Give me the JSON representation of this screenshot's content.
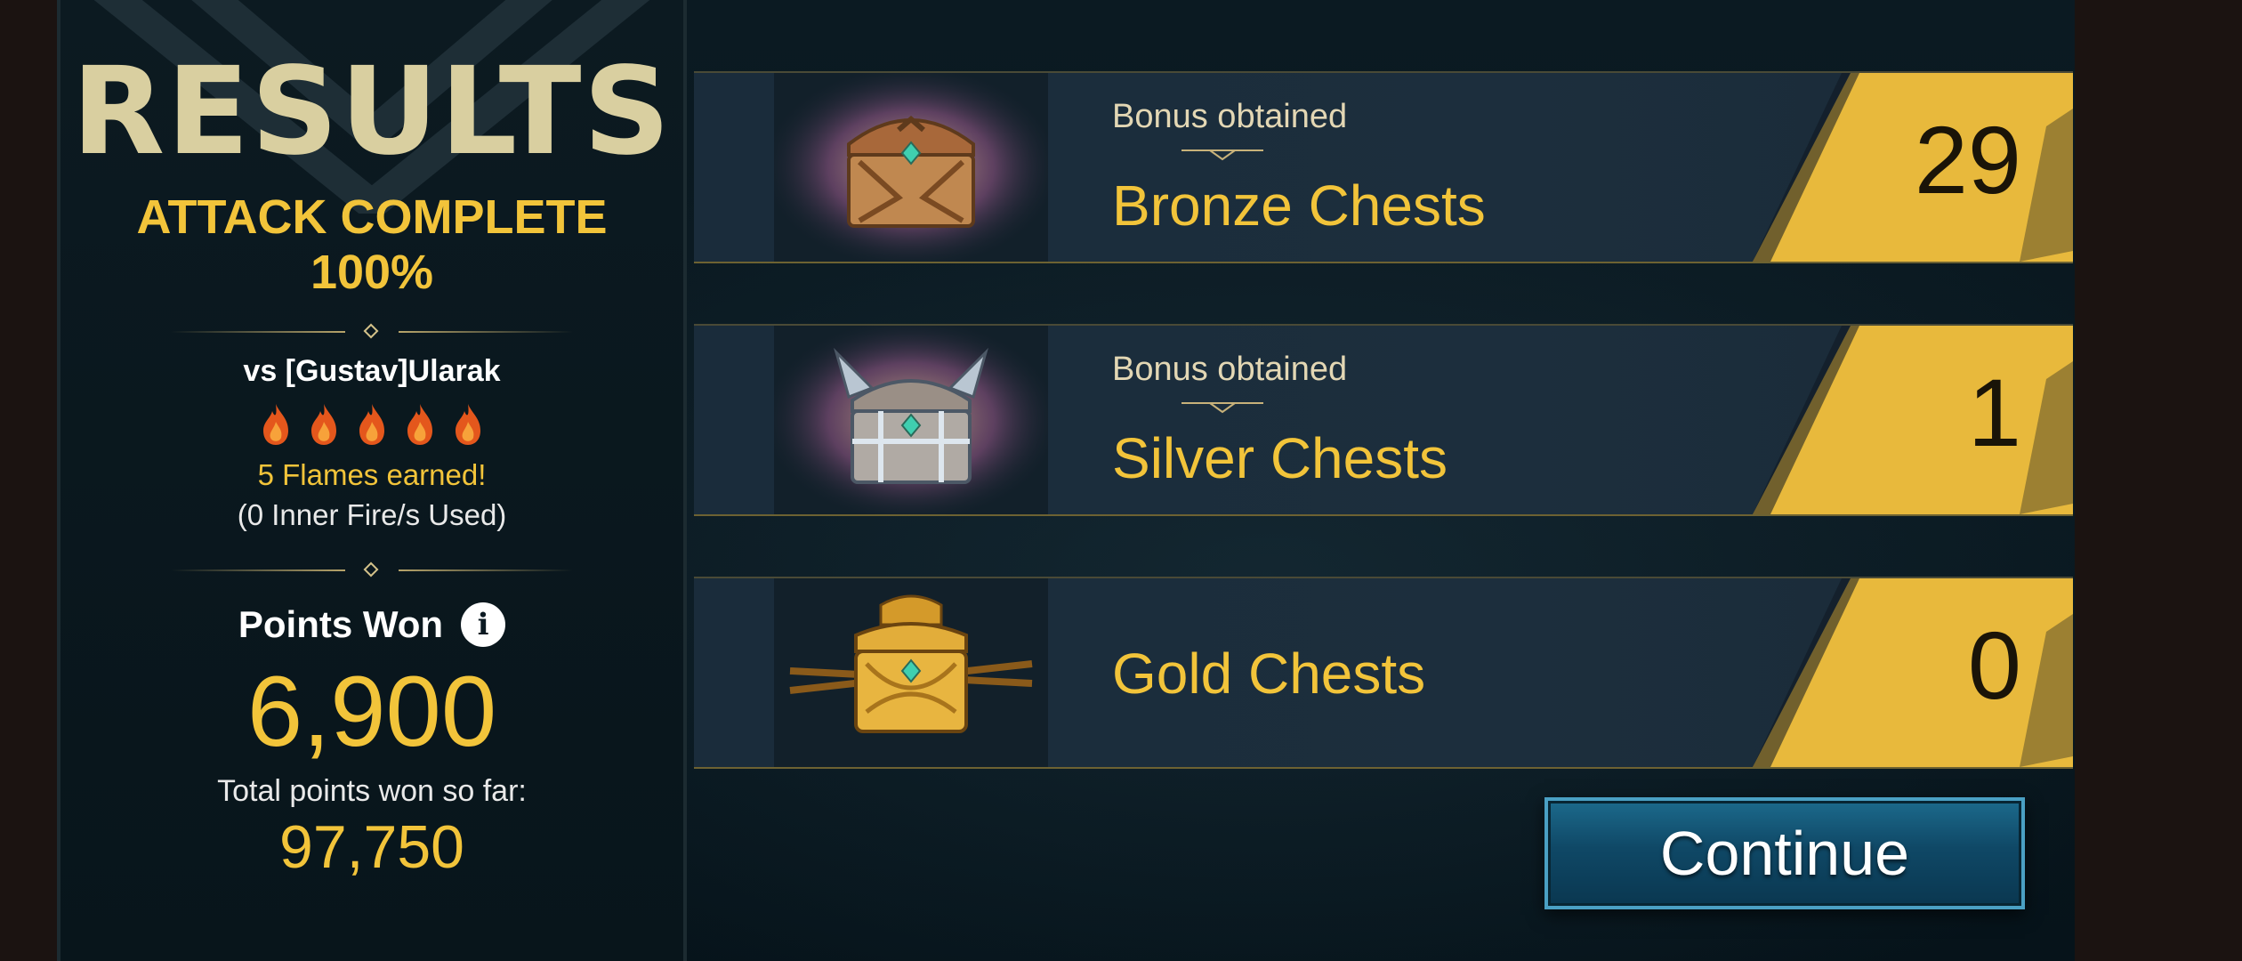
{
  "results": {
    "title": "RESULTS",
    "attack_line": "ATTACK COMPLETE",
    "attack_percent": "100%",
    "opponent": "vs [Gustav]Ularak",
    "flames_count": 5,
    "flames_earned": "5 Flames earned!",
    "inner_fire": "(0 Inner Fire/s Used)",
    "points_label": "Points Won",
    "points_value": "6,900",
    "total_label": "Total points won so far:",
    "total_value": "97,750"
  },
  "chests": [
    {
      "bonus_label": "Bonus obtained",
      "name": "Bronze Chests",
      "count": "29",
      "icon": "bronze-chest-icon"
    },
    {
      "bonus_label": "Bonus obtained",
      "name": "Silver Chests",
      "count": "1",
      "icon": "silver-chest-icon"
    },
    {
      "bonus_label": "",
      "name": "Gold Chests",
      "count": "0",
      "icon": "gold-chest-icon"
    }
  ],
  "continue_label": "Continue",
  "colors": {
    "gold_text": "#f2c43a",
    "title_text": "#d9cfa0",
    "count_panel": "#e8b93c",
    "button_blue": "#0f4866"
  }
}
